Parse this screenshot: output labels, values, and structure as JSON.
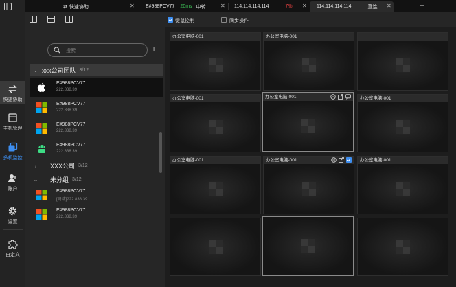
{
  "tabs": [
    {
      "label": "快速协助",
      "active": false
    },
    {
      "label": "E#988PCV77",
      "latency": "20ms",
      "route": "中转",
      "active": false
    },
    {
      "label": "114.114.114.114",
      "badge": "7%",
      "active": false
    },
    {
      "label": "114.114.114.114",
      "mode": "直连",
      "active": true
    }
  ],
  "rail": {
    "items": [
      {
        "label": "快速协助",
        "icon": "swap-arrows-icon"
      },
      {
        "label": "主机管理",
        "icon": "host-icon"
      },
      {
        "label": "多机监控",
        "icon": "multi-monitor-icon"
      },
      {
        "label": "账户",
        "icon": "account-icon"
      },
      {
        "label": "设置",
        "icon": "gear-icon"
      },
      {
        "label": "自定义",
        "icon": "puzzle-icon"
      }
    ]
  },
  "panel": {
    "search_placeholder": "搜索",
    "groups": [
      {
        "name": "xxx公司团队",
        "count": "3/12"
      },
      {
        "name": "XXX公司",
        "count": "3/12"
      },
      {
        "name": "未分组",
        "count": "3/12"
      }
    ],
    "devices": [
      {
        "name": "E#988PCV77",
        "ip": "222.838.39",
        "os": "apple"
      },
      {
        "name": "E#988PCV77",
        "ip": "222.838.39",
        "os": "windows"
      },
      {
        "name": "E#988PCV77",
        "ip": "222.838.39",
        "os": "windows"
      },
      {
        "name": "E#988PCV77",
        "ip": "222.838.39",
        "os": "android"
      },
      {
        "name": "E#988PCV77",
        "ip": "[局域]222.838.39",
        "os": "windows"
      },
      {
        "name": "E#988PCV77",
        "ip": "222.838.39",
        "os": "windows"
      }
    ]
  },
  "toolbar": {
    "keyboard_mouse_label": "键鼠控制",
    "sync_label": "同步操作"
  },
  "tiles": [
    {
      "title": "办公室电脑-001"
    },
    {
      "title": "办公室电脑-001"
    },
    {
      "title": ""
    },
    {
      "title": "办公室电脑-001"
    },
    {
      "title": "办公室电脑-001"
    },
    {
      "title": "办公室电脑-001"
    },
    {
      "title": "办公室电脑-001"
    },
    {
      "title": "办公室电脑-001"
    },
    {
      "title": "办公室电脑-001"
    },
    {
      "title": ""
    },
    {
      "title": ""
    },
    {
      "title": ""
    }
  ],
  "colors": {
    "accent": "#3d8ef0",
    "green": "#3fca5a",
    "red": "#e04040"
  }
}
